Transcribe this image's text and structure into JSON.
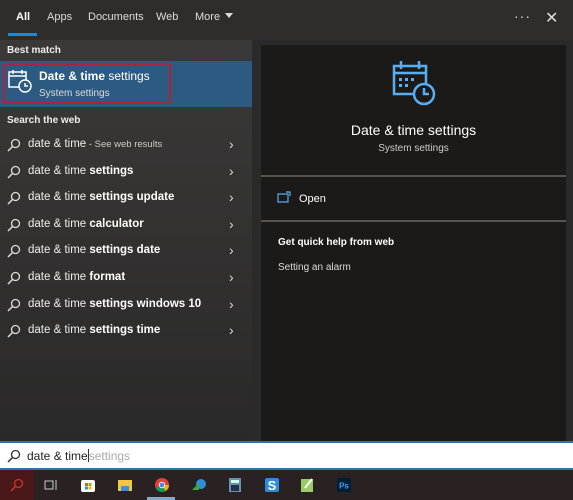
{
  "tabs": [
    {
      "label": "All",
      "active": true
    },
    {
      "label": "Apps"
    },
    {
      "label": "Documents"
    },
    {
      "label": "Web"
    },
    {
      "label": "More"
    }
  ],
  "top_actions": {
    "more_options": "···",
    "close": "✕"
  },
  "best_match": {
    "heading": "Best match",
    "title_bold": "Date & time",
    "title_rest": " settings",
    "subtitle": "System settings",
    "icon": "calendar-clock-icon",
    "highlight_color": "#b3203a"
  },
  "web": {
    "heading": "Search the web",
    "items": [
      {
        "query": "date & time",
        "suffix": "",
        "small": " - See web results"
      },
      {
        "query": "date & time",
        "suffix": " settings"
      },
      {
        "query": "date & time",
        "suffix": " settings update"
      },
      {
        "query": "date & time",
        "suffix": " calculator"
      },
      {
        "query": "date & time",
        "suffix": " settings date"
      },
      {
        "query": "date & time",
        "suffix": " format"
      },
      {
        "query": "date & time",
        "suffix": " settings windows 10"
      },
      {
        "query": "date & time",
        "suffix": " settings time"
      }
    ]
  },
  "preview": {
    "title": "Date & time settings",
    "subtitle": "System settings",
    "open_label": "Open",
    "help_heading": "Get quick help from web",
    "help_links": [
      "Setting an alarm"
    ]
  },
  "search": {
    "typed": "date & time",
    "suggestion": "settings"
  },
  "taskbar": [
    "search-icon",
    "task-view-icon",
    "store-icon",
    "file-explorer-icon",
    "chrome-icon",
    "download-manager-icon",
    "calculator-icon",
    "snagit-icon",
    "notepad-icon",
    "photoshop-icon"
  ],
  "colors": {
    "accent": "#2a72b5",
    "selected": "#2c5a80",
    "icon_blue": "#5aaef0"
  }
}
